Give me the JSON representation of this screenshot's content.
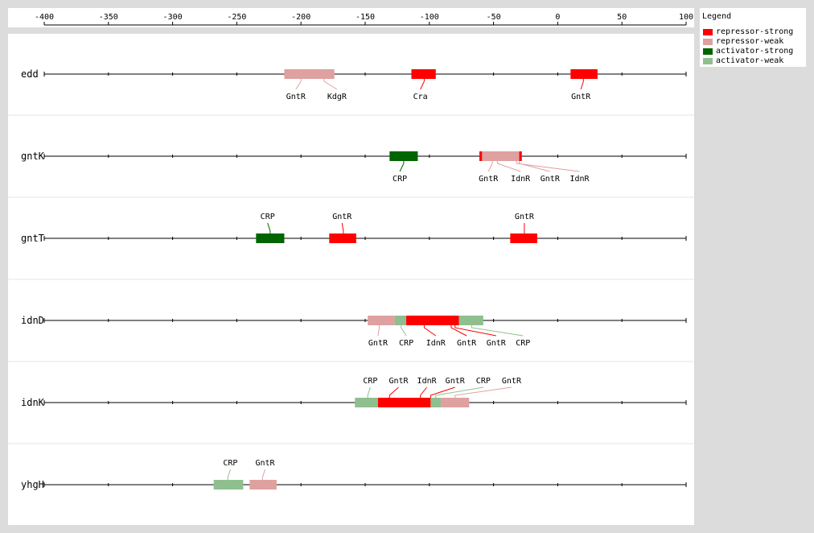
{
  "axis": {
    "ticks": [
      -400,
      -350,
      -300,
      -250,
      -200,
      -150,
      -100,
      -50,
      0,
      50,
      100
    ],
    "domain": [
      -400,
      100
    ]
  },
  "legend": {
    "title": "Legend",
    "items": [
      {
        "label": "repressor-strong",
        "color": "#ff0000",
        "key": "repressor-strong"
      },
      {
        "label": "repressor-weak",
        "color": "#dfa0a0",
        "key": "repressor-weak"
      },
      {
        "label": "activator-strong",
        "color": "#006400",
        "key": "activator-strong"
      },
      {
        "label": "activator-weak",
        "color": "#8fbf8f",
        "key": "activator-weak"
      }
    ]
  },
  "genes": [
    {
      "name": "edd",
      "sites": [
        {
          "start": -213,
          "end": -174,
          "type": "repressor-weak"
        },
        {
          "start": -114,
          "end": -95,
          "type": "repressor-strong"
        },
        {
          "start": 10,
          "end": 31,
          "type": "repressor-strong"
        }
      ],
      "labels": [
        {
          "text": "GntR",
          "side": "below",
          "site": 0,
          "anchor": -200,
          "pos": -204
        },
        {
          "text": "KdgR",
          "side": "below",
          "site": 0,
          "anchor": -182,
          "pos": -172
        },
        {
          "text": "Cra",
          "side": "below",
          "site": 1,
          "anchor": -104,
          "pos": -107
        },
        {
          "text": "GntR",
          "side": "below",
          "site": 2,
          "anchor": 20,
          "pos": 18
        }
      ]
    },
    {
      "name": "gntK",
      "sites": [
        {
          "start": -131,
          "end": -109,
          "type": "activator-strong"
        },
        {
          "start": -61,
          "end": -28,
          "type": "repressor-weak"
        },
        {
          "start": -61,
          "end": -59,
          "type": "repressor-strong"
        },
        {
          "start": -30,
          "end": -28,
          "type": "repressor-strong"
        }
      ],
      "labels": [
        {
          "text": "CRP",
          "side": "below",
          "site": 0,
          "anchor": -120,
          "pos": -123
        },
        {
          "text": "GntR",
          "side": "below",
          "site": 1,
          "anchor": -51,
          "pos": -54
        },
        {
          "text": "IdnR",
          "side": "below",
          "site": 1,
          "anchor": -47,
          "pos": -29
        },
        {
          "text": "GntR",
          "side": "below",
          "site": 1,
          "anchor": -30,
          "pos": -6
        },
        {
          "text": "IdnR",
          "side": "below",
          "site": 1,
          "anchor": -32,
          "pos": 17
        }
      ]
    },
    {
      "name": "gntT",
      "sites": [
        {
          "start": -235,
          "end": -213,
          "type": "activator-strong"
        },
        {
          "start": -178,
          "end": -157,
          "type": "repressor-strong"
        },
        {
          "start": -37,
          "end": -16,
          "type": "repressor-strong"
        }
      ],
      "labels": [
        {
          "text": "CRP",
          "side": "above",
          "site": 0,
          "anchor": -224,
          "pos": -226
        },
        {
          "text": "GntR",
          "side": "above",
          "site": 1,
          "anchor": -167,
          "pos": -168
        },
        {
          "text": "GntR",
          "side": "above",
          "site": 2,
          "anchor": -26,
          "pos": -26
        }
      ]
    },
    {
      "name": "idnD",
      "sites": [
        {
          "start": -148,
          "end": -127,
          "type": "repressor-weak"
        },
        {
          "start": -127,
          "end": -118,
          "type": "activator-weak"
        },
        {
          "start": -118,
          "end": -77,
          "type": "repressor-strong"
        },
        {
          "start": -77,
          "end": -58,
          "type": "activator-weak"
        }
      ],
      "labels": [
        {
          "text": "GntR",
          "side": "below",
          "site": 0,
          "anchor": -139,
          "pos": -140
        },
        {
          "text": "CRP",
          "side": "below",
          "site": 1,
          "anchor": -122,
          "pos": -118
        },
        {
          "text": "IdnR",
          "side": "below",
          "site": 2,
          "anchor": -104,
          "pos": -95
        },
        {
          "text": "GntR",
          "side": "below",
          "site": 2,
          "anchor": -83,
          "pos": -71
        },
        {
          "text": "GntR",
          "side": "below",
          "site": 2,
          "anchor": -80,
          "pos": -48
        },
        {
          "text": "CRP",
          "side": "below",
          "site": 3,
          "anchor": -67,
          "pos": -27
        }
      ]
    },
    {
      "name": "idnK",
      "sites": [
        {
          "start": -158,
          "end": -140,
          "type": "activator-weak"
        },
        {
          "start": -140,
          "end": -99,
          "type": "repressor-strong"
        },
        {
          "start": -99,
          "end": -91,
          "type": "activator-weak"
        },
        {
          "start": -91,
          "end": -69,
          "type": "repressor-weak"
        }
      ],
      "labels": [
        {
          "text": "CRP",
          "side": "above",
          "site": 0,
          "anchor": -148,
          "pos": -146
        },
        {
          "text": "GntR",
          "side": "above",
          "site": 1,
          "anchor": -131,
          "pos": -124
        },
        {
          "text": "IdnR",
          "side": "above",
          "site": 1,
          "anchor": -107,
          "pos": -102
        },
        {
          "text": "GntR",
          "side": "above",
          "site": 1,
          "anchor": -99,
          "pos": -80
        },
        {
          "text": "CRP",
          "side": "above",
          "site": 2,
          "anchor": -95,
          "pos": -58
        },
        {
          "text": "GntR",
          "side": "above",
          "site": 3,
          "anchor": -80,
          "pos": -36
        }
      ]
    },
    {
      "name": "yhgH",
      "sites": [
        {
          "start": -268,
          "end": -245,
          "type": "activator-weak"
        },
        {
          "start": -240,
          "end": -219,
          "type": "repressor-weak"
        }
      ],
      "labels": [
        {
          "text": "CRP",
          "side": "above",
          "site": 0,
          "anchor": -257,
          "pos": -255
        },
        {
          "text": "GntR",
          "side": "above",
          "site": 1,
          "anchor": -230,
          "pos": -228
        }
      ]
    }
  ]
}
